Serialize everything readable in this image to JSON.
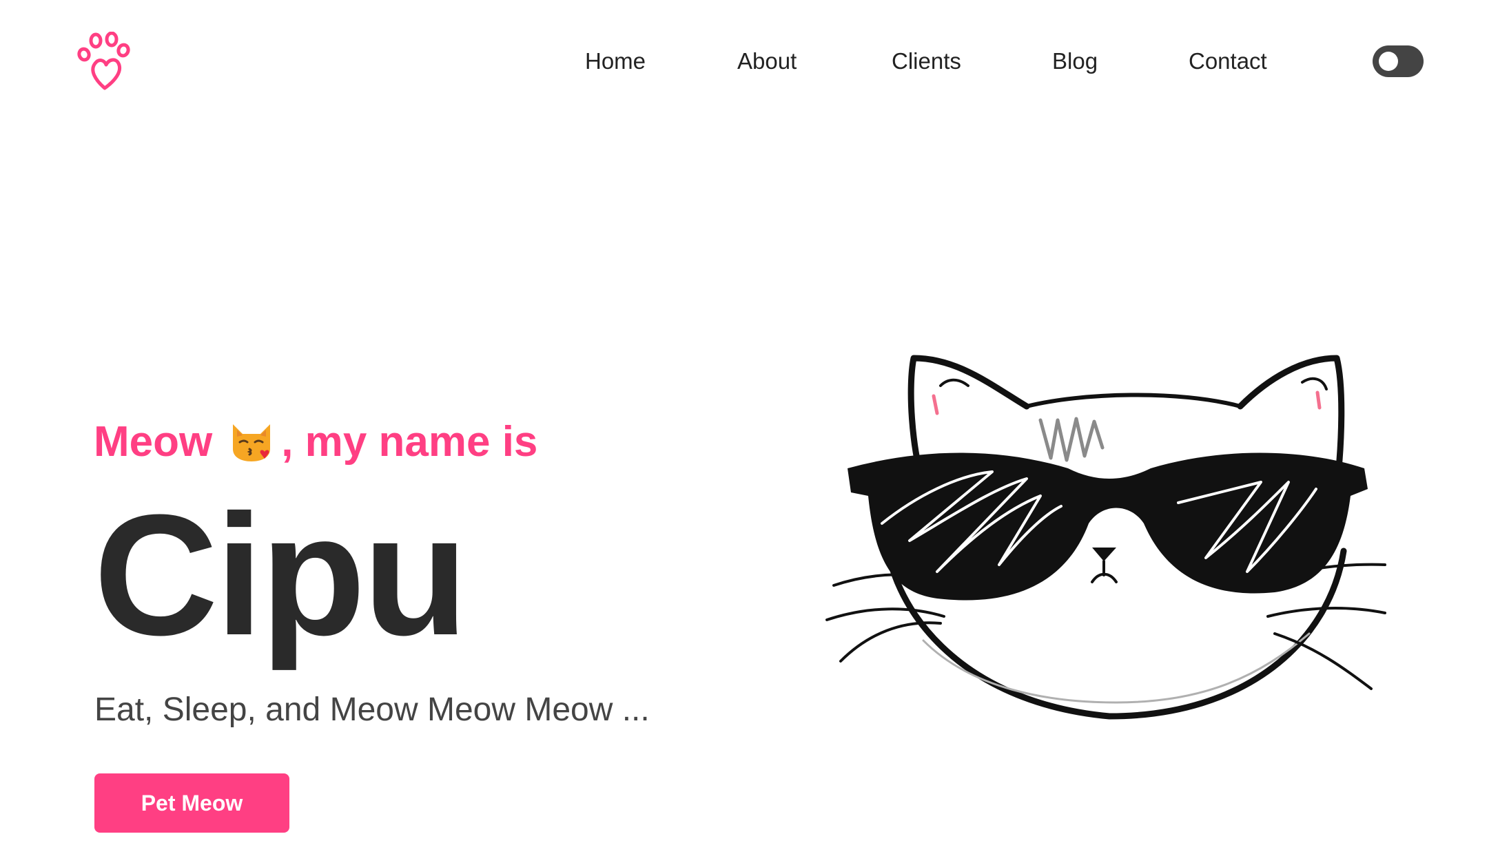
{
  "header": {
    "logo_icon": "paw-heart-icon",
    "nav": [
      {
        "label": "Home"
      },
      {
        "label": "About"
      },
      {
        "label": "Clients"
      },
      {
        "label": "Blog"
      },
      {
        "label": "Contact"
      }
    ],
    "theme_toggle_icon": "toggle-switch-icon"
  },
  "hero": {
    "greeting_start": "Meow",
    "greeting_emoji_icon": "kissing-cat-emoji-icon",
    "greeting_end": ", my name is",
    "name": "Cipu",
    "tagline": "Eat, Sleep, and Meow Meow Meow ...",
    "cta_label": "Pet Meow",
    "illustration_icon": "cat-with-sunglasses-illustration"
  },
  "colors": {
    "accent": "#ff3f83",
    "heading": "#2a2a2a",
    "body_text": "#444444",
    "toggle_track": "#444444",
    "background": "#ffffff"
  }
}
